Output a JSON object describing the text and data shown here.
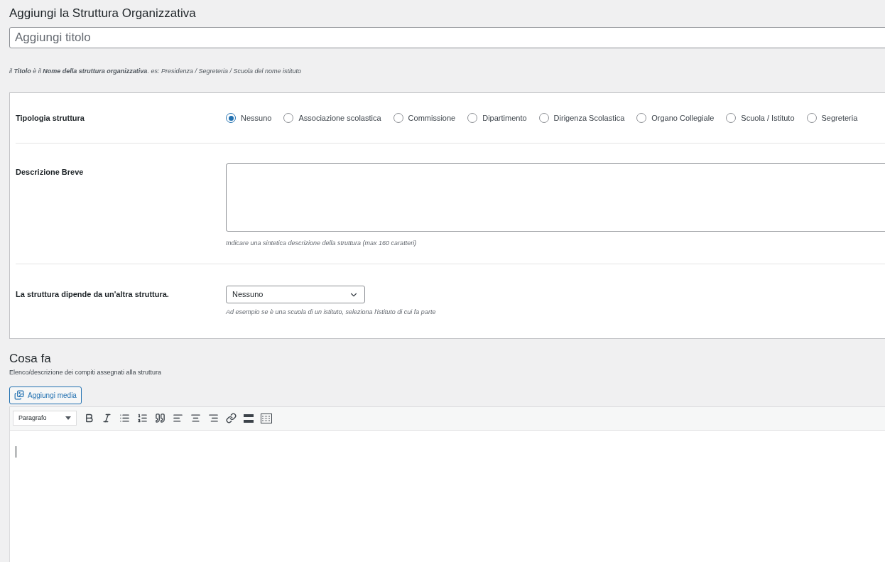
{
  "page_title": "Aggiungi la Struttura Organizzativa",
  "title_field": {
    "placeholder": "Aggiungi titolo"
  },
  "title_hint": "il **Titolo** è il **Nome della struttura organizzativa**. es: Presidenza / Segreteria / Scuola del nome istituto",
  "metabox": {
    "type_field": {
      "label": "Tipologia struttura",
      "options": [
        {
          "label": "Nessuno",
          "selected": true
        },
        {
          "label": "Associazione scolastica",
          "selected": false
        },
        {
          "label": "Commissione",
          "selected": false
        },
        {
          "label": "Dipartimento",
          "selected": false
        },
        {
          "label": "Dirigenza Scolastica",
          "selected": false
        },
        {
          "label": "Organo Collegiale",
          "selected": false
        },
        {
          "label": "Scuola / Istituto",
          "selected": false
        },
        {
          "label": "Segreteria",
          "selected": false
        }
      ]
    },
    "description_field": {
      "label": "Descrizione Breve",
      "hint": "Indicare una sintetica descrizione della struttura (max 160 caratteri)"
    },
    "parent_field": {
      "label": "La struttura dipende da un'altra struttura.",
      "value": "Nessuno",
      "hint": "Ad esempio se è una scuola di un istituto, seleziona l'istituto di cui fa parte"
    }
  },
  "section": {
    "title": "Cosa fa",
    "subtitle": "Elenco/descrizione dei compiti assegnati alla struttura"
  },
  "editor": {
    "media_button": "Aggiungi media",
    "format_select": "Paragrafo"
  }
}
